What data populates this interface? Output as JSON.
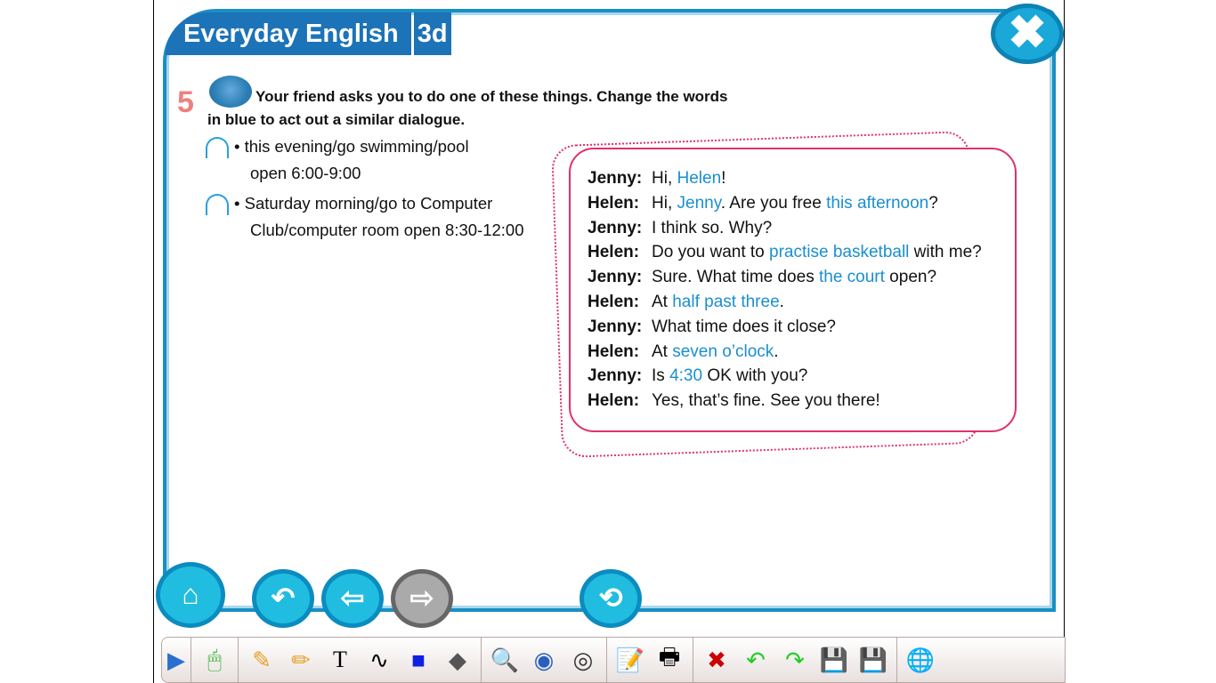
{
  "header": {
    "title": "Everyday English",
    "unit": "3d"
  },
  "exercise": {
    "number": "5",
    "instruction": "Your friend asks you to do one of these things. Change the words in blue to act out a similar dialogue.",
    "options": [
      {
        "line1": "this evening/go swimming/pool",
        "line2": "open 6:00-9:00"
      },
      {
        "line1": "Saturday morning/go to Computer",
        "line2": "Club/computer room open 8:30-12:00"
      }
    ]
  },
  "dialogue": [
    {
      "speaker": "Jenny:",
      "parts": [
        {
          "t": "Hi, "
        },
        {
          "t": "Helen",
          "blue": true
        },
        {
          "t": "!"
        }
      ]
    },
    {
      "speaker": "Helen:",
      "parts": [
        {
          "t": "Hi, "
        },
        {
          "t": "Jenny",
          "blue": true
        },
        {
          "t": ". Are you free "
        },
        {
          "t": "this afternoon",
          "blue": true
        },
        {
          "t": "?"
        }
      ]
    },
    {
      "speaker": "Jenny:",
      "parts": [
        {
          "t": "I think so. Why?"
        }
      ]
    },
    {
      "speaker": "Helen:",
      "parts": [
        {
          "t": "Do you want to "
        },
        {
          "t": "practise basketball",
          "blue": true
        },
        {
          "t": " with me?"
        }
      ]
    },
    {
      "speaker": "Jenny:",
      "parts": [
        {
          "t": "Sure. What time does "
        },
        {
          "t": "the court",
          "blue": true
        },
        {
          "t": " open?"
        }
      ]
    },
    {
      "speaker": "Helen:",
      "parts": [
        {
          "t": "At "
        },
        {
          "t": "half past three",
          "blue": true
        },
        {
          "t": "."
        }
      ]
    },
    {
      "speaker": "Jenny:",
      "parts": [
        {
          "t": "What time does it close?"
        }
      ]
    },
    {
      "speaker": "Helen:",
      "parts": [
        {
          "t": "At "
        },
        {
          "t": "seven o’clock",
          "blue": true
        },
        {
          "t": "."
        }
      ]
    },
    {
      "speaker": "Jenny:",
      "parts": [
        {
          "t": "Is "
        },
        {
          "t": "4:30",
          "blue": true
        },
        {
          "t": " OK with you?"
        }
      ]
    },
    {
      "speaker": "Helen:",
      "parts": [
        {
          "t": "Yes, that’s fine. See you there!"
        }
      ]
    }
  ],
  "icons": {
    "close": "✖",
    "home": "⌂",
    "back": "↶",
    "prev": "⇦",
    "next": "⇨",
    "replay": "⟲",
    "text_tool": "T"
  },
  "colors": {
    "accent": "#1c73b7",
    "highlight": "#1a8fd0",
    "frame": "#e0306a"
  }
}
